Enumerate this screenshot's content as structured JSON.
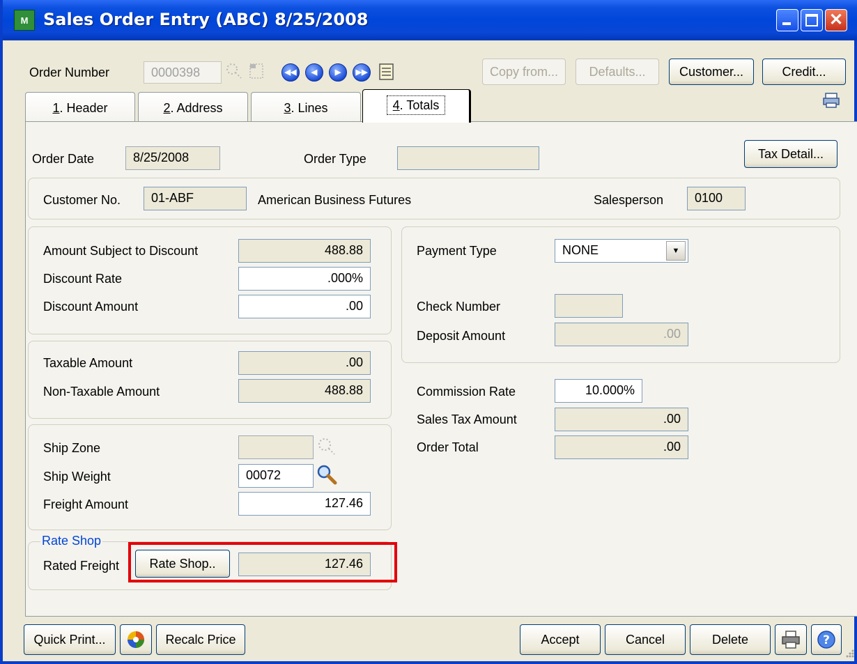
{
  "window": {
    "title": "Sales Order Entry (ABC) 8/25/2008",
    "app_icon_text": "M"
  },
  "toolbar": {
    "order_number_label": "Order Number",
    "order_number_value": "0000398",
    "copy_from_label": "Copy from...",
    "defaults_label": "Defaults...",
    "customer_label": "Customer...",
    "credit_label": "Credit..."
  },
  "tabs": [
    {
      "num": "1",
      "label": ". Header"
    },
    {
      "num": "2",
      "label": ". Address"
    },
    {
      "num": "3",
      "label": ". Lines"
    },
    {
      "num": "4",
      "label": ". Totals"
    }
  ],
  "header": {
    "order_date_label": "Order Date",
    "order_date_value": "8/25/2008",
    "order_type_label": "Order Type",
    "order_type_value": "",
    "tax_detail_label": "Tax Detail..."
  },
  "customer": {
    "customer_no_label": "Customer No.",
    "customer_no_value": "01-ABF",
    "customer_name": "American Business Futures",
    "salesperson_label": "Salesperson",
    "salesperson_value": "0100"
  },
  "discount": {
    "amount_subject_label": "Amount Subject to Discount",
    "amount_subject_value": "488.88",
    "discount_rate_label": "Discount Rate",
    "discount_rate_value": ".000%",
    "discount_amount_label": "Discount Amount",
    "discount_amount_value": ".00"
  },
  "tax": {
    "taxable_label": "Taxable Amount",
    "taxable_value": ".00",
    "non_taxable_label": "Non-Taxable Amount",
    "non_taxable_value": "488.88"
  },
  "shipping": {
    "ship_zone_label": "Ship Zone",
    "ship_zone_value": "",
    "ship_weight_label": "Ship Weight",
    "ship_weight_value": "00072",
    "freight_label": "Freight Amount",
    "freight_value": "127.46"
  },
  "rate_shop": {
    "group_label": "Rate Shop",
    "rated_freight_label": "Rated Freight",
    "button_label": "Rate Shop..",
    "value": "127.46"
  },
  "payment": {
    "payment_type_label": "Payment Type",
    "payment_type_value": "NONE",
    "check_number_label": "Check Number",
    "check_number_value": "",
    "deposit_label": "Deposit Amount",
    "deposit_value": ".00"
  },
  "totals": {
    "commission_label": "Commission Rate",
    "commission_value": "10.000%",
    "sales_tax_label": "Sales Tax Amount",
    "sales_tax_value": ".00",
    "order_total_label": "Order Total",
    "order_total_value": ".00"
  },
  "footer": {
    "quick_print_label": "Quick Print...",
    "recalc_price_label": "Recalc Price",
    "accept_label": "Accept",
    "cancel_label": "Cancel",
    "delete_label": "Delete"
  },
  "colors": {
    "title_bar": "#0046d9",
    "highlight": "#e3000b",
    "group_caption": "#0046d5"
  }
}
